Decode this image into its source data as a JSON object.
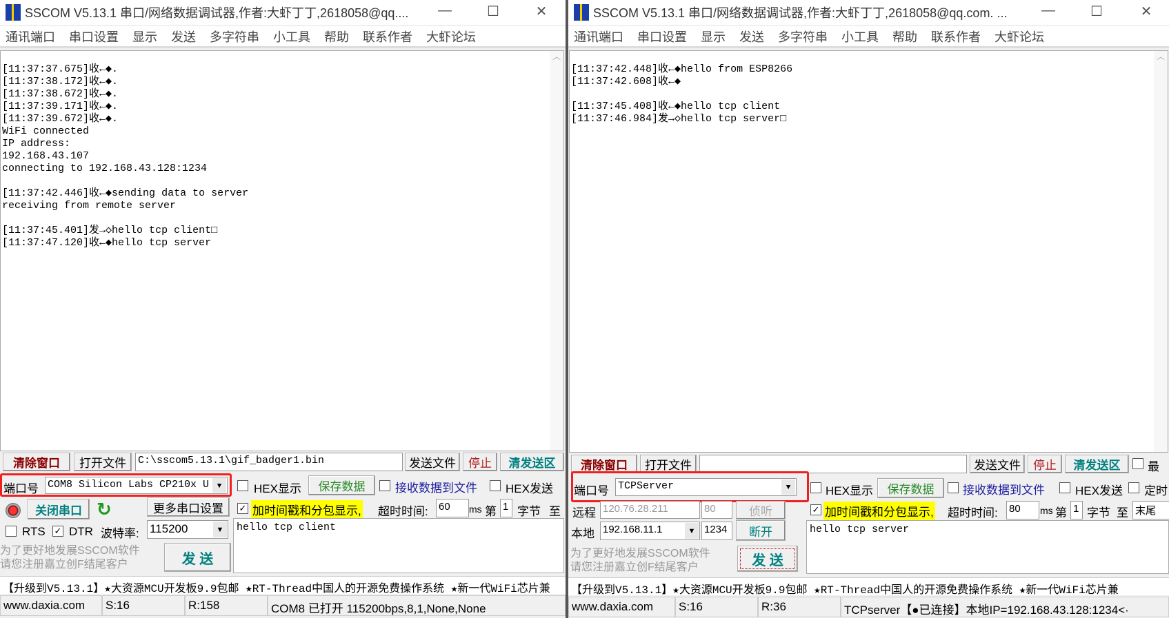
{
  "left": {
    "title": "SSCOM V5.13.1 串口/网络数据调试器,作者:大虾丁丁,2618058@qq....",
    "menu": [
      "通讯端口",
      "串口设置",
      "显示",
      "发送",
      "多字符串",
      "小工具",
      "帮助",
      "联系作者",
      "大虾论坛"
    ],
    "receive_text": "[11:37:37.675]收←◆.\n[11:37:38.172]收←◆.\n[11:37:38.672]收←◆.\n[11:37:39.171]收←◆.\n[11:37:39.672]收←◆.\nWiFi connected\nIP address:\n192.168.43.107\nconnecting to 192.168.43.128:1234\n\n[11:37:42.446]收←◆sending data to server\nreceiving from remote server\n\n[11:37:45.401]发→◇hello tcp client□\n[11:37:47.120]收←◆hello tcp server",
    "clear_window": "清除窗口",
    "open_file": "打开文件",
    "file_path": "C:\\sscom5.13.1\\gif_badger1.bin",
    "send_file": "发送文件",
    "stop": "停止",
    "clear_send": "清发送区",
    "port_label": "端口号",
    "port_value": "COM8 Silicon Labs CP210x U",
    "hex_display": "HEX显示",
    "save_data": "保存数据",
    "recv_to_file": "接收数据到文件",
    "hex_send": "HEX发送",
    "close_port": "关闭串口",
    "more_settings": "更多串口设置",
    "timestamp": "加时间戳和分包显示,",
    "timeout_label": "超时时间:",
    "timeout_value": "60",
    "ms": "ms",
    "byte_from": "第",
    "byte_from_value": "1",
    "byte_unit": "字节",
    "to": "至",
    "rts": "RTS",
    "dtr": "DTR",
    "baud_label": "波特率:",
    "baud_value": "115200",
    "send_text": "hello tcp client",
    "promo1": "为了更好地发展SSCOM软件",
    "promo2": "请您注册嘉立创F结尾客户",
    "send": "发 送",
    "ticker": "【升级到V5.13.1】★大资源MCU开发板9.9包邮 ★RT-Thread中国人的开源免费操作系统 ★新一代WiFi芯片兼",
    "status": [
      "www.daxia.com",
      "S:16",
      "R:158",
      "COM8 已打开  115200bps,8,1,None,None"
    ]
  },
  "right": {
    "title": "SSCOM V5.13.1 串口/网络数据调试器,作者:大虾丁丁,2618058@qq.com. ...",
    "menu": [
      "通讯端口",
      "串口设置",
      "显示",
      "发送",
      "多字符串",
      "小工具",
      "帮助",
      "联系作者",
      "大虾论坛"
    ],
    "receive_text": "[11:37:42.448]收←◆hello from ESP8266\n[11:37:42.608]收←◆\n\n[11:37:45.408]收←◆hello tcp client\n[11:37:46.984]发→◇hello tcp server□",
    "clear_window": "清除窗口",
    "open_file": "打开文件",
    "file_path": "",
    "send_file": "发送文件",
    "stop": "停止",
    "clear_send": "清发送区",
    "max_label": "最",
    "port_label": "端口号",
    "port_value": "TCPServer",
    "hex_display": "HEX显示",
    "save_data": "保存数据",
    "recv_to_file": "接收数据到文件",
    "hex_send": "HEX发送",
    "timed": "定时",
    "remote_label": "远程",
    "remote_ip": "120.76.28.211",
    "remote_port": "80",
    "listen": "侦听",
    "local_label": "本地",
    "local_ip": "192.168.11.1",
    "local_port": "1234",
    "disconnect": "断开",
    "timestamp": "加时间戳和分包显示,",
    "timeout_label": "超时时间:",
    "timeout_value": "80",
    "ms": "ms",
    "byte_from": "第",
    "byte_from_value": "1",
    "byte_unit": "字节",
    "to": "至",
    "to_value": "末尾",
    "send_text": "hello tcp server",
    "promo1": "为了更好地发展SSCOM软件",
    "promo2": "请您注册嘉立创F结尾客户",
    "send": "发 送",
    "ticker": "【升级到V5.13.1】★大资源MCU开发板9.9包邮 ★RT-Thread中国人的开源免费操作系统 ★新一代WiFi芯片兼",
    "status": [
      "www.daxia.com",
      "S:16",
      "R:36",
      "TCPserver【●已连接】本地IP=192.168.43.128:1234<·"
    ]
  },
  "colors": {
    "highlight_box": "#f02020",
    "timestamp_bg": "#ffff00",
    "clear_window": "#8b0000",
    "save_data": "#2a8a2a",
    "clear_send": "#008080",
    "recv_to_file": "#1a1aa0"
  }
}
